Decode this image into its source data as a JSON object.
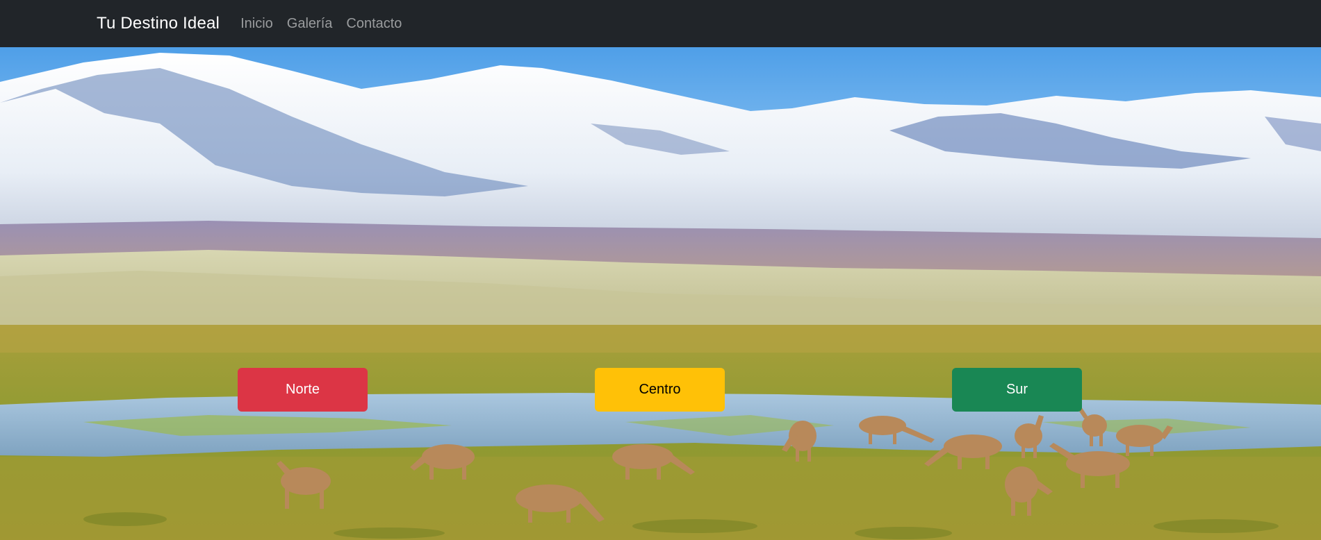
{
  "navbar": {
    "brand": "Tu Destino Ideal",
    "links": [
      {
        "label": "Inicio"
      },
      {
        "label": "Galería"
      },
      {
        "label": "Contacto"
      }
    ]
  },
  "hero": {
    "image_icon": "andes-landscape-with-vicunas",
    "buttons": [
      {
        "label": "Norte",
        "bg": "#dc3545",
        "fg": "#ffffff"
      },
      {
        "label": "Centro",
        "bg": "#ffc107",
        "fg": "#000000"
      },
      {
        "label": "Sur",
        "bg": "#198754",
        "fg": "#ffffff"
      }
    ]
  },
  "colors": {
    "navbar_bg": "#212529",
    "brand_text": "#ffffff",
    "nav_link_text": "#9a9c9e"
  }
}
